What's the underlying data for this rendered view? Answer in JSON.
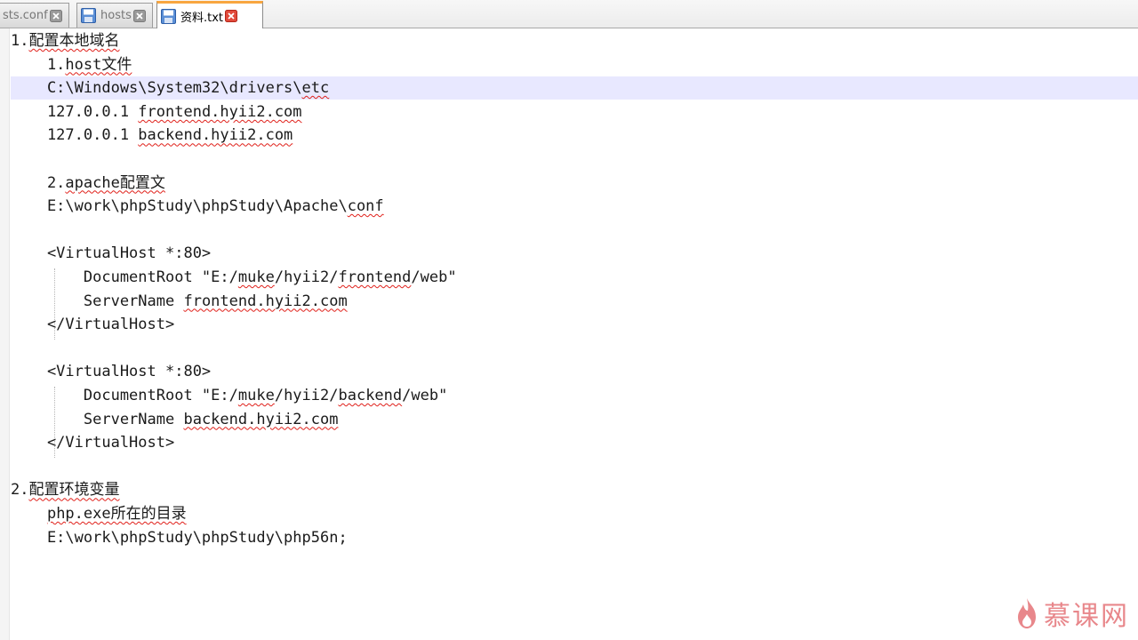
{
  "tabs": [
    {
      "label": "sts.conf",
      "active": false
    },
    {
      "label": "hosts",
      "active": false
    },
    {
      "label": "资料.txt",
      "active": true
    }
  ],
  "editor": {
    "lines": [
      {
        "segments": [
          {
            "t": "1."
          },
          {
            "t": "配置本地域名",
            "s": true
          }
        ]
      },
      {
        "segments": [
          {
            "t": "    1."
          },
          {
            "t": "host文件",
            "s": true
          }
        ]
      },
      {
        "segments": [
          {
            "t": "    C:\\Windows\\System32\\drivers\\"
          },
          {
            "t": "etc",
            "s": true
          }
        ],
        "current": true
      },
      {
        "segments": [
          {
            "t": "    127.0.0.1 "
          },
          {
            "t": "frontend.hyii2.com",
            "s": true
          }
        ]
      },
      {
        "segments": [
          {
            "t": "    127.0.0.1 "
          },
          {
            "t": "backend.hyii2.com",
            "s": true
          }
        ]
      },
      {
        "segments": []
      },
      {
        "segments": [
          {
            "t": "    2."
          },
          {
            "t": "apache配置文",
            "s": true
          }
        ]
      },
      {
        "segments": [
          {
            "t": "    E:\\work\\phpStudy\\phpStudy\\Apache\\"
          },
          {
            "t": "conf",
            "s": true
          }
        ]
      },
      {
        "segments": []
      },
      {
        "segments": [
          {
            "t": "    <VirtualHost *:80>"
          }
        ]
      },
      {
        "segments": [
          {
            "t": "        DocumentRoot \"E:/"
          },
          {
            "t": "muke",
            "s": true
          },
          {
            "t": "/hyii2/"
          },
          {
            "t": "frontend",
            "s": true
          },
          {
            "t": "/web\""
          }
        ]
      },
      {
        "segments": [
          {
            "t": "        ServerName "
          },
          {
            "t": "frontend.hyii2.com",
            "s": true
          }
        ]
      },
      {
        "segments": [
          {
            "t": "    </VirtualHost>"
          }
        ]
      },
      {
        "segments": []
      },
      {
        "segments": [
          {
            "t": "    <VirtualHost *:80>"
          }
        ]
      },
      {
        "segments": [
          {
            "t": "        DocumentRoot \"E:/"
          },
          {
            "t": "muke",
            "s": true
          },
          {
            "t": "/hyii2/"
          },
          {
            "t": "backend",
            "s": true
          },
          {
            "t": "/web\""
          }
        ]
      },
      {
        "segments": [
          {
            "t": "        ServerName "
          },
          {
            "t": "backend.hyii2.com",
            "s": true
          }
        ]
      },
      {
        "segments": [
          {
            "t": "    </VirtualHost>"
          }
        ]
      },
      {
        "segments": []
      },
      {
        "segments": [
          {
            "t": "2."
          },
          {
            "t": "配置环境变量",
            "s": true
          }
        ]
      },
      {
        "segments": [
          {
            "t": "    "
          },
          {
            "t": "php.exe所在的目录",
            "s": true
          }
        ]
      },
      {
        "segments": [
          {
            "t": "    E:\\work\\phpStudy\\phpStudy\\php56n;"
          }
        ]
      }
    ]
  },
  "watermark": {
    "text": "慕课网"
  },
  "colors": {
    "current_line": "#e8e8ff",
    "active_tab_accent": "#f8a640",
    "spell_underline": "#e0201a",
    "watermark": "#d7262d"
  },
  "icons": {
    "tab_file": "save-icon",
    "tab_close": "close-icon",
    "watermark": "flame-icon"
  }
}
